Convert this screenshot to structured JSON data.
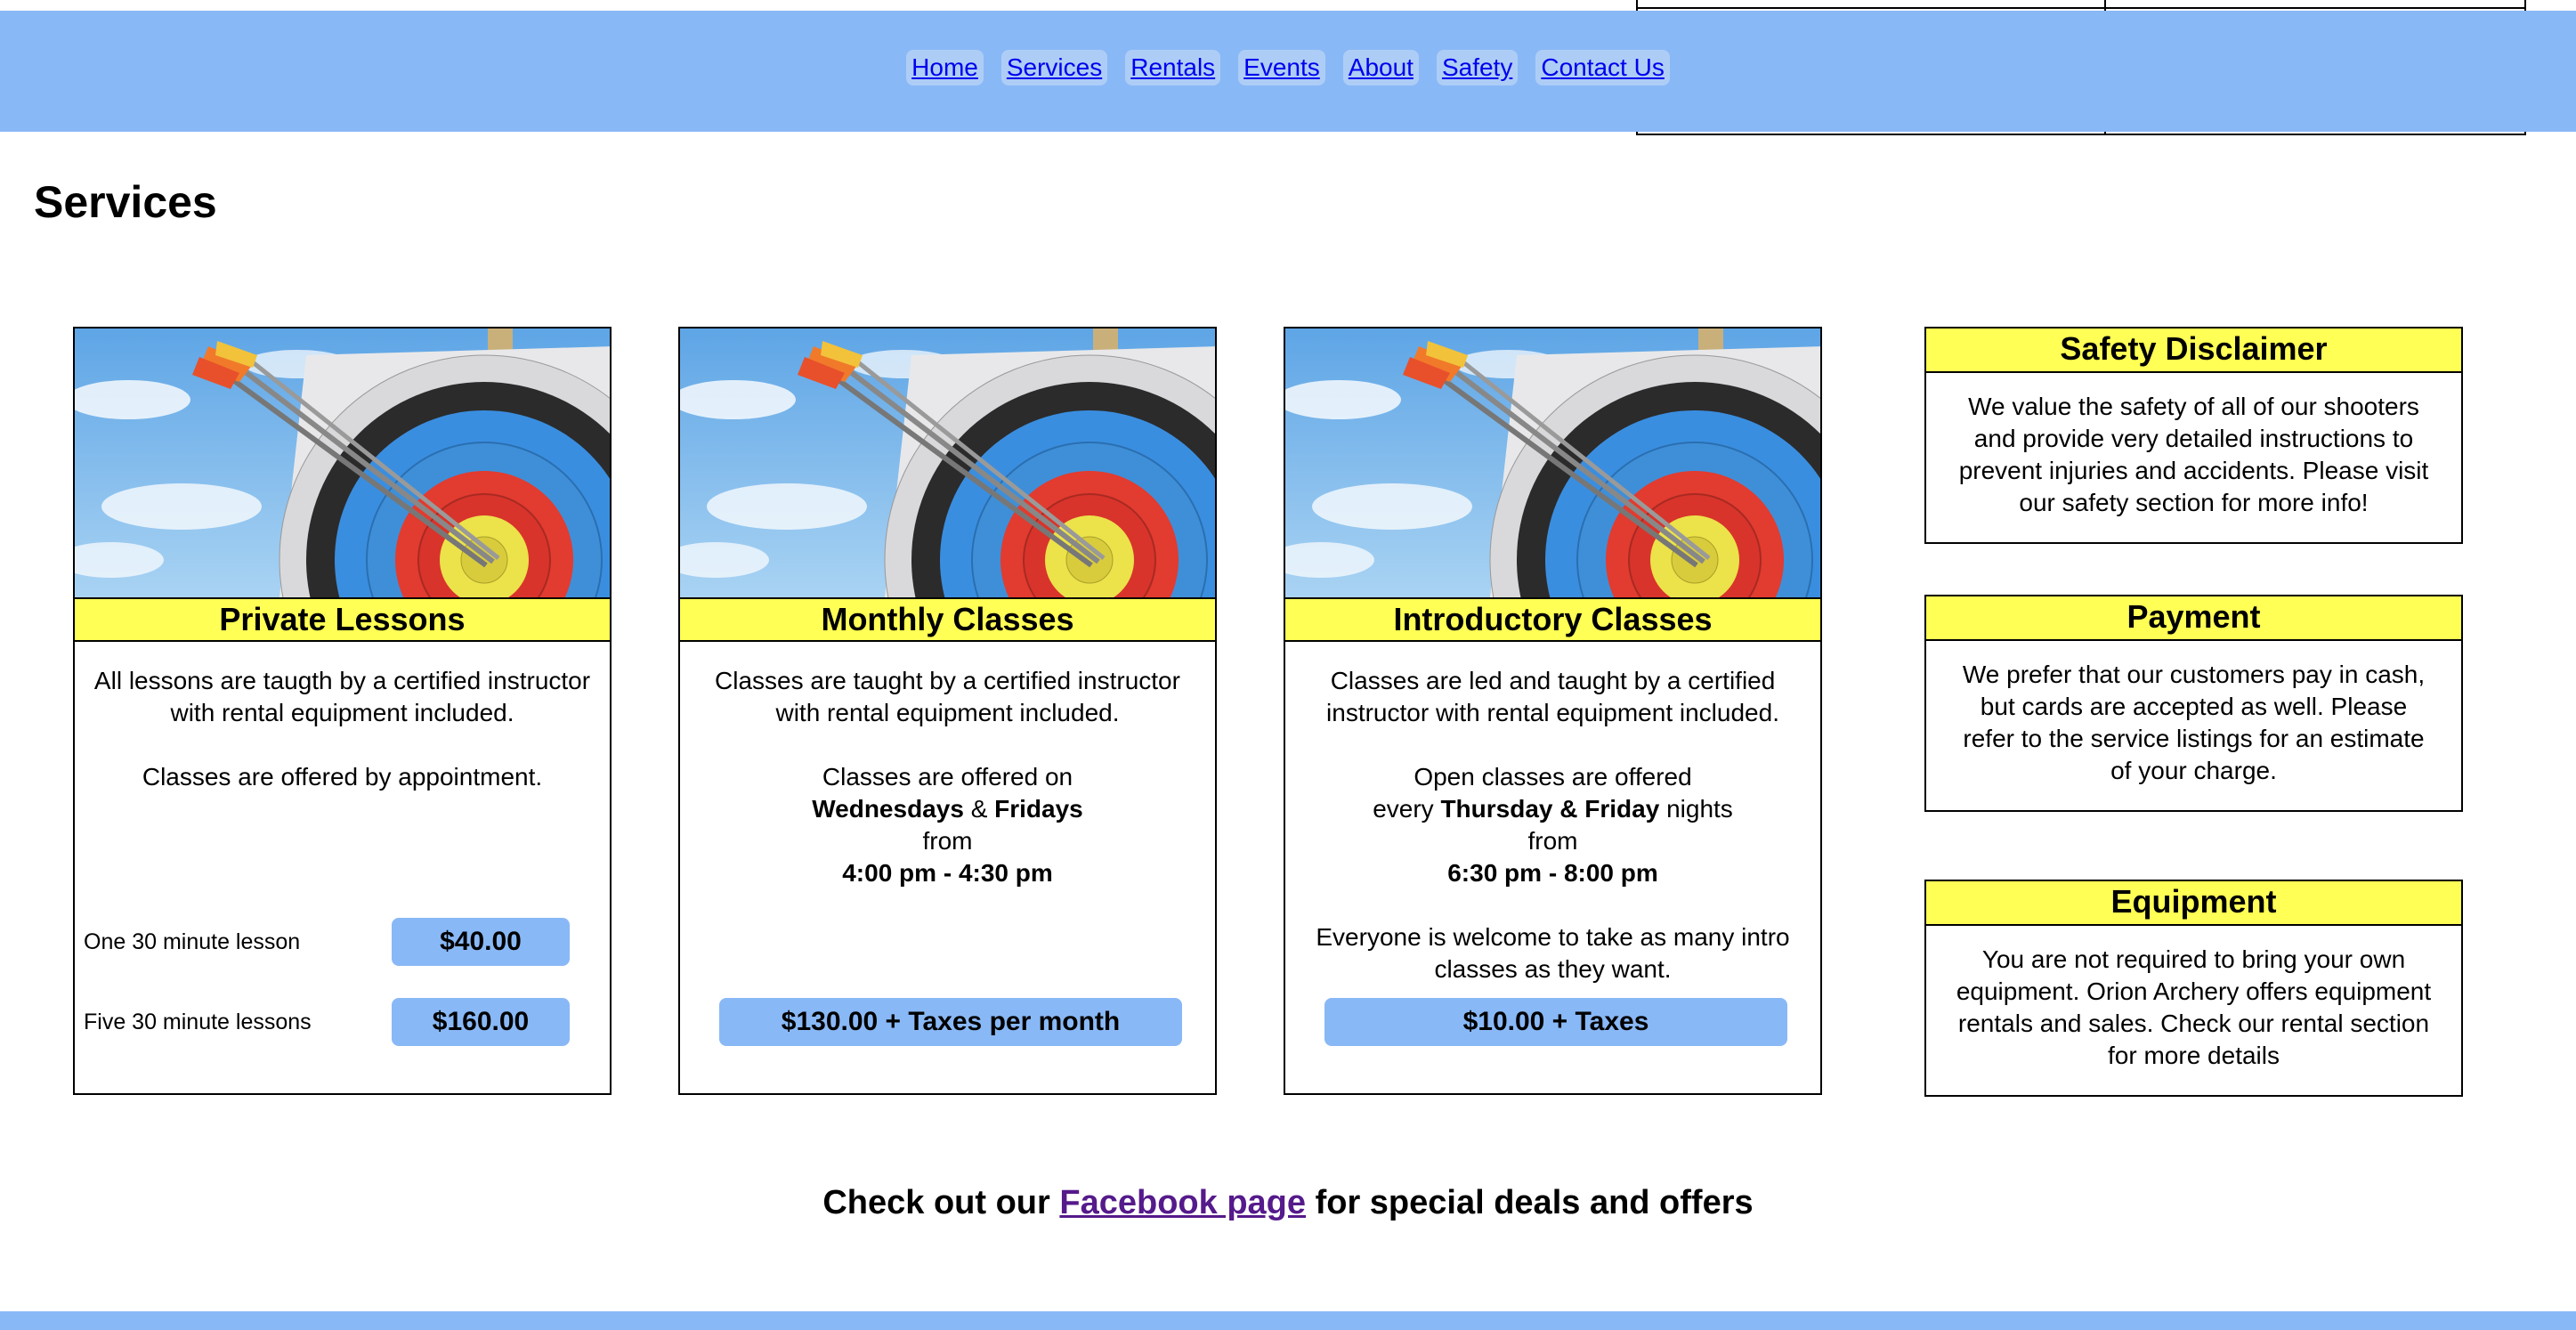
{
  "nav": {
    "items": [
      "Home",
      "Services",
      "Rentals",
      "Events",
      "About",
      "Safety",
      "Contact Us"
    ]
  },
  "page": {
    "title": "Services"
  },
  "cards": [
    {
      "title": "Private Lessons",
      "paragraphs": [
        "All lessons are taugth by a certified instructor with rental equipment included.",
        "Classes are offered by appointment."
      ],
      "prices": [
        {
          "label": "One 30 minute lesson",
          "price": "$40.00"
        },
        {
          "label": "Five 30 minute lessons",
          "price": "$160.00"
        }
      ]
    },
    {
      "title": "Monthly Classes",
      "p1": "Classes are taught by a certified instructor with rental equipment included.",
      "p2_a": "Classes are offered on",
      "p2_days_1": "Wednesdays",
      "p2_amp": "&",
      "p2_days_2": "Fridays",
      "p2_from": "from",
      "p2_time": "4:00 pm - 4:30 pm",
      "price": "$130.00 + Taxes per month"
    },
    {
      "title": "Introductory Classes",
      "p1": "Classes are led and taught by a certified instructor with rental equipment included.",
      "p2_a": "Open classes are offered",
      "p2_every": "every",
      "p2_days_1": "Thursday",
      "p2_amp": "&",
      "p2_days_2": "Friday",
      "p2_nights": "nights",
      "p2_from": "from",
      "p2_time": "6:30 pm - 8:00 pm",
      "p3": "Everyone is welcome to take as many intro classes as they want.",
      "price": "$10.00 + Taxes"
    }
  ],
  "sidebar": [
    {
      "title": "Safety Disclaimer",
      "text": "We value the safety of all of our shooters and provide very detailed instructions to prevent injuries and accidents. Please visit our safety section for more info!"
    },
    {
      "title": "Payment",
      "text": "We prefer that our customers pay in cash, but cards are accepted as well. Please refer to the service listings for an estimate of your charge."
    },
    {
      "title": "Equipment",
      "text": "You are not required to bring your own equipment. Orion Archery offers equipment rentals and sales. Check our rental section for more details"
    }
  ],
  "promo": {
    "before": "Check out our",
    "link": "Facebook page",
    "after": "for special deals and offers"
  },
  "colors": {
    "header_bg": "#89b8f6",
    "title_bar": "#ffff55",
    "price_button": "#89b8f6"
  }
}
